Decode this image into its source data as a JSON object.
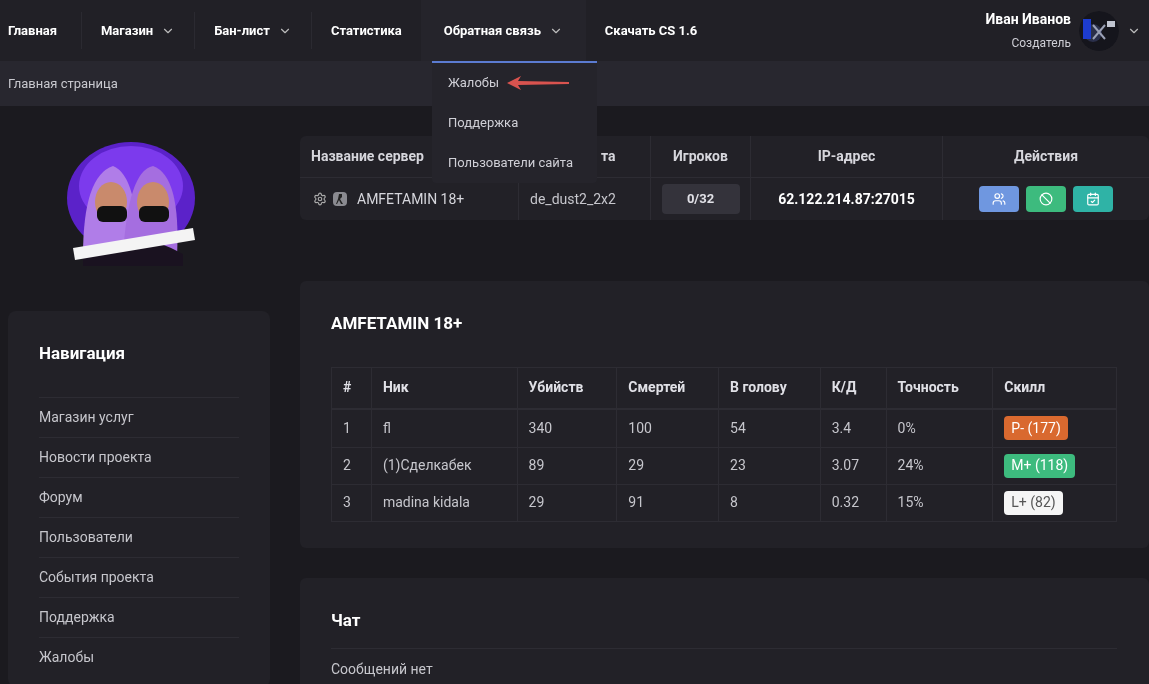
{
  "nav": [
    {
      "label": "Главная",
      "dropdown": false,
      "selected": false
    },
    {
      "label": "Магазин",
      "dropdown": true,
      "selected": false
    },
    {
      "label": "Бан-лист",
      "dropdown": true,
      "selected": false
    },
    {
      "label": "Статистика",
      "dropdown": false,
      "selected": false
    },
    {
      "label": "Обратная связь",
      "dropdown": true,
      "selected": true
    },
    {
      "label": "Скачать CS 1.6",
      "dropdown": false,
      "selected": false
    }
  ],
  "user": {
    "name": "Иван Иванов",
    "role": "Создатель"
  },
  "breadcrumb": "Главная страница",
  "dropdown_menu": {
    "items": [
      {
        "label": "Жалобы",
        "pointed": true
      },
      {
        "label": "Поддержка",
        "pointed": false
      },
      {
        "label": "Пользователи сайта",
        "pointed": false
      }
    ]
  },
  "server_table": {
    "columns": [
      "Название сервер",
      "та",
      "Игроков",
      "IP-адрес",
      "Действия"
    ],
    "rows": [
      {
        "name": "AMFETAMIN 18+",
        "map": "de_dust2_2x2",
        "players": "0/32",
        "ip": "62.122.214.87:27015"
      }
    ]
  },
  "sidebar": {
    "title": "Навигация",
    "items": [
      "Магазин услуг",
      "Новости проекта",
      "Форум",
      "Пользователи",
      "События проекта",
      "Поддержка",
      "Жалобы"
    ]
  },
  "stats": {
    "title": "AMFETAMIN 18+",
    "columns": [
      "#",
      "Ник",
      "Убийств",
      "Смертей",
      "В голову",
      "К/Д",
      "Точность",
      "Скилл"
    ],
    "rows": [
      {
        "cells": [
          "1",
          "fl",
          "340",
          "100",
          "54",
          "3.4",
          "0%"
        ],
        "skill": "P- (177)",
        "color": "#d9692f"
      },
      {
        "cells": [
          "2",
          "(1)Сделкабек",
          "89",
          "29",
          "23",
          "3.07",
          "24%"
        ],
        "skill": "M+ (118)",
        "color": "#3dbb7e"
      },
      {
        "cells": [
          "3",
          "madina kidala",
          "29",
          "91",
          "8",
          "0.32",
          "15%"
        ],
        "skill": "L+ (82)",
        "color": "#f5f5f5"
      }
    ]
  },
  "chat": {
    "title": "Чат",
    "empty_text": "Сообщений нет"
  }
}
